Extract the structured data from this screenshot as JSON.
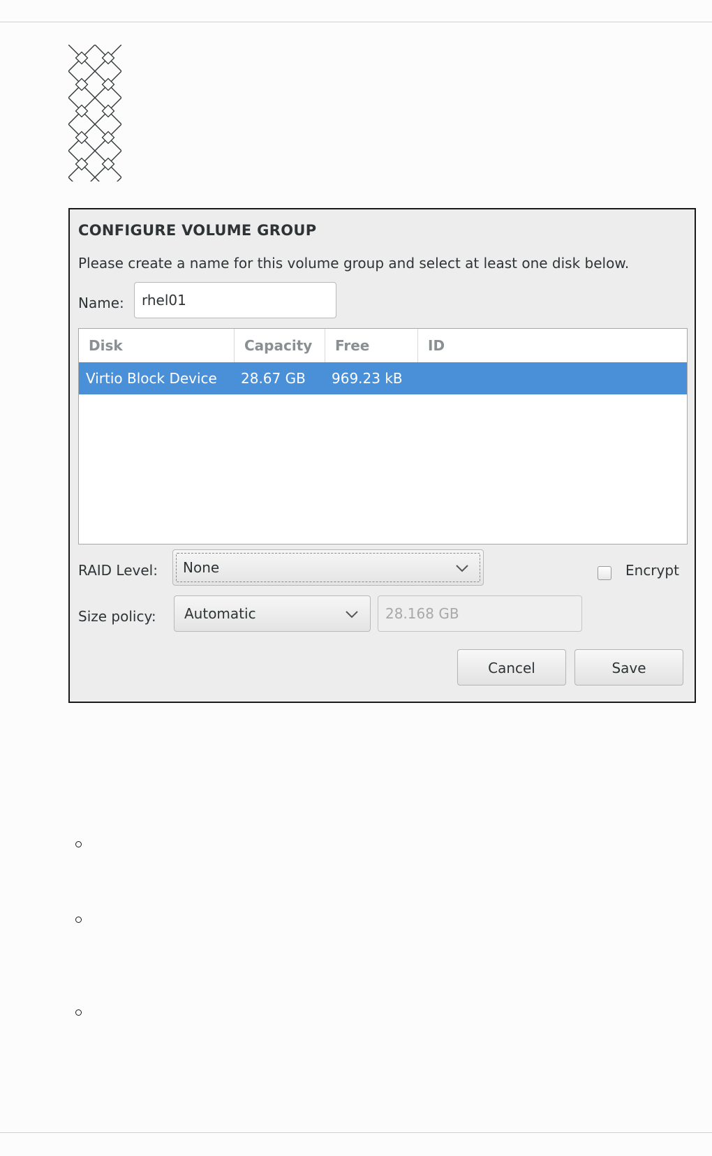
{
  "dialog": {
    "title": "CONFIGURE VOLUME GROUP",
    "description": "Please create a name for this volume group and select at least one disk below.",
    "name_label": "Name:",
    "name_value": "rhel01"
  },
  "disk_table": {
    "columns": [
      "Disk",
      "Capacity",
      "Free",
      "ID"
    ],
    "rows": [
      {
        "disk": "Virtio Block Device",
        "capacity": "28.67 GB",
        "free": "969.23 kB",
        "id": "",
        "selected": true
      }
    ]
  },
  "raid": {
    "label": "RAID Level:",
    "selected": "None"
  },
  "encrypt": {
    "label": "Encrypt",
    "checked": false
  },
  "size_policy": {
    "label": "Size policy:",
    "selected": "Automatic",
    "size_value": "28.168 GB"
  },
  "buttons": {
    "cancel": "Cancel",
    "save": "Save"
  },
  "colors": {
    "selection": "#4a90d9",
    "dialog_bg": "#ededed",
    "border": "#1a1a1a"
  },
  "icons": [
    "chevron-down-icon",
    "checkbox-icon",
    "bullet-icon",
    "decorative-pattern"
  ]
}
